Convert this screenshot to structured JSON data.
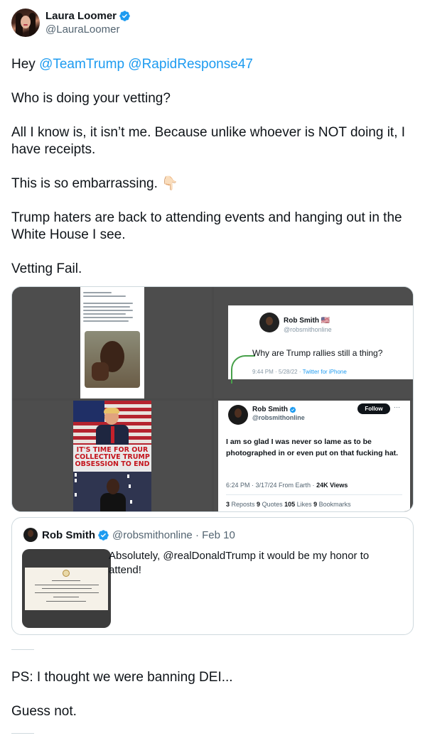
{
  "author": {
    "display_name": "Laura Loomer",
    "handle": "@LauraLoomer",
    "verified_color": "#1d9bf0"
  },
  "tweet": {
    "line1_prefix": "Hey ",
    "mention1": "@TeamTrump",
    "mention2": "@RapidResponse47",
    "p2": "Who is doing your vetting?",
    "p3": "All I know is, it isn’t me. Because unlike whoever is NOT doing it, I have receipts.",
    "p4": "This is so embarrassing.",
    "p4_emoji": "👇🏻",
    "p5": "Trump haters are back to attending events and hanging out in the White House I see.",
    "p6": "Vetting Fail."
  },
  "media": {
    "cell2": {
      "name": "Rob Smith 🇺🇸",
      "handle": "@robsmithonline",
      "text": "Why are Trump rallies still a thing?",
      "time": "9:44 PM · 5/28/22 · ",
      "source": "Twitter for iPhone"
    },
    "cell3": {
      "banner": "IT'S TIME FOR OUR COLLECTIVE TRUMP OBSESSION TO END"
    },
    "cell4": {
      "name": "Rob Smith",
      "handle": "@robsmithonline",
      "follow_label": "Follow",
      "text": "I am so glad I was never so lame as to be photographed in or even put on that fucking hat.",
      "time": "6:24 PM · 3/17/24 From Earth · ",
      "views": "24K Views",
      "reposts_n": "3",
      "reposts_l": " Reposts ",
      "quotes_n": "9",
      "quotes_l": " Quotes ",
      "likes_n": "105",
      "likes_l": " Likes ",
      "bookmarks_n": "9",
      "bookmarks_l": " Bookmarks"
    }
  },
  "quote": {
    "name": "Rob Smith",
    "handle": "@robsmithonline · Feb 10",
    "text": "Absolutely, @realDonaldTrump it would be my honor to attend!"
  },
  "after": {
    "ps": "PS: I thought we were banning DEI...",
    "guess": "Guess not."
  }
}
